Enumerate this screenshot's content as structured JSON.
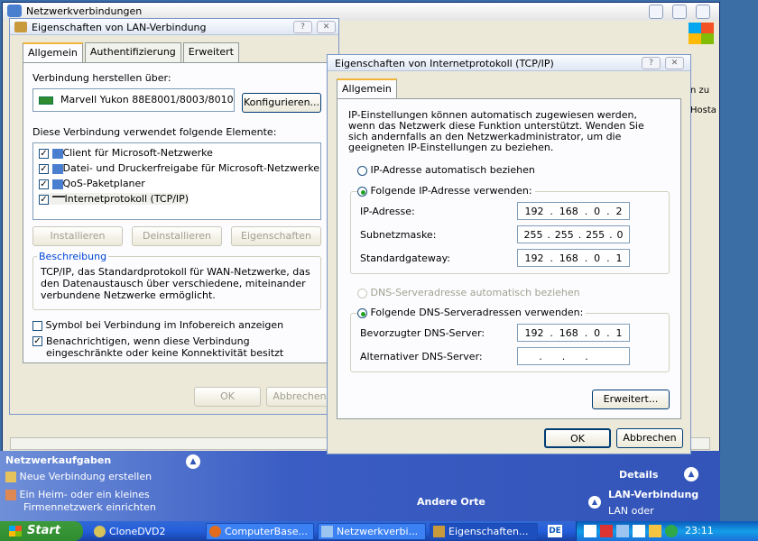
{
  "background_window": {
    "title": "Netzwerkverbindungen",
    "right_snippets": [
      "n zu",
      "Hosta"
    ]
  },
  "task_pane": {
    "tasks_title": "Netzwerkaufgaben",
    "task1": "Neue Verbindung erstellen",
    "task2_line1": "Ein Heim- oder ein kleines",
    "task2_line2": "Firmennetzwerk einrichten",
    "other_places": "Andere Orte",
    "details": "Details",
    "details_item": "LAN-Verbindung",
    "details_sub": "LAN oder"
  },
  "lan_dialog": {
    "title": "Eigenschaften von LAN-Verbindung",
    "tabs": [
      "Allgemein",
      "Authentifizierung",
      "Erweitert"
    ],
    "connect_using_label": "Verbindung herstellen über:",
    "adapter": "Marvell Yukon 88E8001/8003/8010",
    "configure_button": "Konfigurieren...",
    "elements_label": "Diese Verbindung verwendet folgende Elemente:",
    "elements": [
      {
        "label": "Client für Microsoft-Netzwerke"
      },
      {
        "label": "Datei- und Druckerfreigabe für Microsoft-Netzwerke"
      },
      {
        "label": "QoS-Paketplaner"
      },
      {
        "label": "Internetprotokoll (TCP/IP)"
      }
    ],
    "install_button": "Installieren",
    "uninstall_button": "Deinstallieren",
    "properties_button": "Eigenschaften",
    "description_group": "Beschreibung",
    "description_text": "TCP/IP, das Standardprotokoll für WAN-Netzwerke, das den Datenaustausch über verschiedene, miteinander verbundene Netzwerke ermöglicht.",
    "tray_icon_label": "Symbol bei Verbindung im Infobereich anzeigen",
    "notify_label": "Benachrichtigen, wenn diese Verbindung eingeschränkte oder keine Konnektivität besitzt",
    "ok": "OK",
    "cancel": "Abbrechen"
  },
  "tcpip_dialog": {
    "title": "Eigenschaften von Internetprotokoll (TCP/IP)",
    "tab": "Allgemein",
    "info_text": "IP-Einstellungen können automatisch zugewiesen werden, wenn das Netzwerk diese Funktion unterstützt. Wenden Sie sich andernfalls an den Netzwerkadministrator, um die geeigneten IP-Einstellungen zu beziehen.",
    "auto_ip": "IP-Adresse automatisch beziehen",
    "manual_ip": "Folgende IP-Adresse verwenden:",
    "ip_label": "IP-Adresse:",
    "subnet_label": "Subnetzmaske:",
    "gateway_label": "Standardgateway:",
    "ip": [
      "192",
      "168",
      "0",
      "2"
    ],
    "subnet": [
      "255",
      "255",
      "255",
      "0"
    ],
    "gateway": [
      "192",
      "168",
      "0",
      "1"
    ],
    "auto_dns": "DNS-Serveradresse automatisch beziehen",
    "manual_dns": "Folgende DNS-Serveradressen verwenden:",
    "pref_dns_label": "Bevorzugter DNS-Server:",
    "alt_dns_label": "Alternativer DNS-Server:",
    "pref_dns": [
      "192",
      "168",
      "0",
      "1"
    ],
    "advanced_button": "Erweitert...",
    "ok": "OK",
    "cancel": "Abbrechen"
  },
  "taskbar": {
    "start": "Start",
    "items": [
      "CloneDVD2",
      "ComputerBase...",
      "Netzwerkverbi...",
      "Eigenschaften..."
    ],
    "lang": "DE",
    "clock": "23:11"
  }
}
